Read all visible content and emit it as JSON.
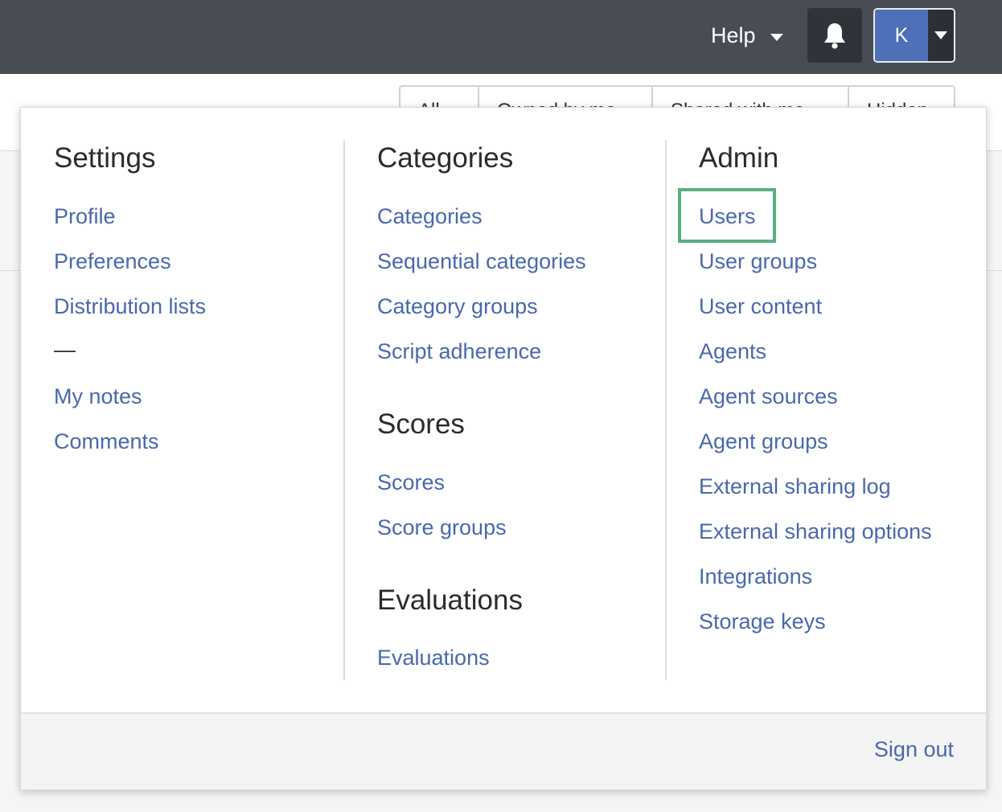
{
  "topbar": {
    "help_label": "Help",
    "bell_icon": "bell-icon",
    "avatar_initial": "K"
  },
  "background_tabs": [
    "All",
    "Owned by me",
    "Shared with me",
    "Hidden"
  ],
  "menu": {
    "settings": {
      "title": "Settings",
      "items": [
        "Profile",
        "Preferences",
        "Distribution lists",
        "—",
        "My notes",
        "Comments"
      ]
    },
    "categories": {
      "title": "Categories",
      "items": [
        "Categories",
        "Sequential categories",
        "Category groups",
        "Script adherence"
      ]
    },
    "scores": {
      "title": "Scores",
      "items": [
        "Scores",
        "Score groups"
      ]
    },
    "evaluations": {
      "title": "Evaluations",
      "items": [
        "Evaluations"
      ]
    },
    "admin": {
      "title": "Admin",
      "items": [
        "Users",
        "User groups",
        "User content",
        "Agents",
        "Agent sources",
        "Agent groups",
        "External sharing log",
        "External sharing options",
        "Integrations",
        "Storage keys"
      ]
    },
    "footer": {
      "signout_label": "Sign out"
    }
  },
  "colors": {
    "topbar": "#474c55",
    "link": "#4a68ad",
    "avatar": "#4e70b9",
    "highlight": "#5aae80"
  }
}
